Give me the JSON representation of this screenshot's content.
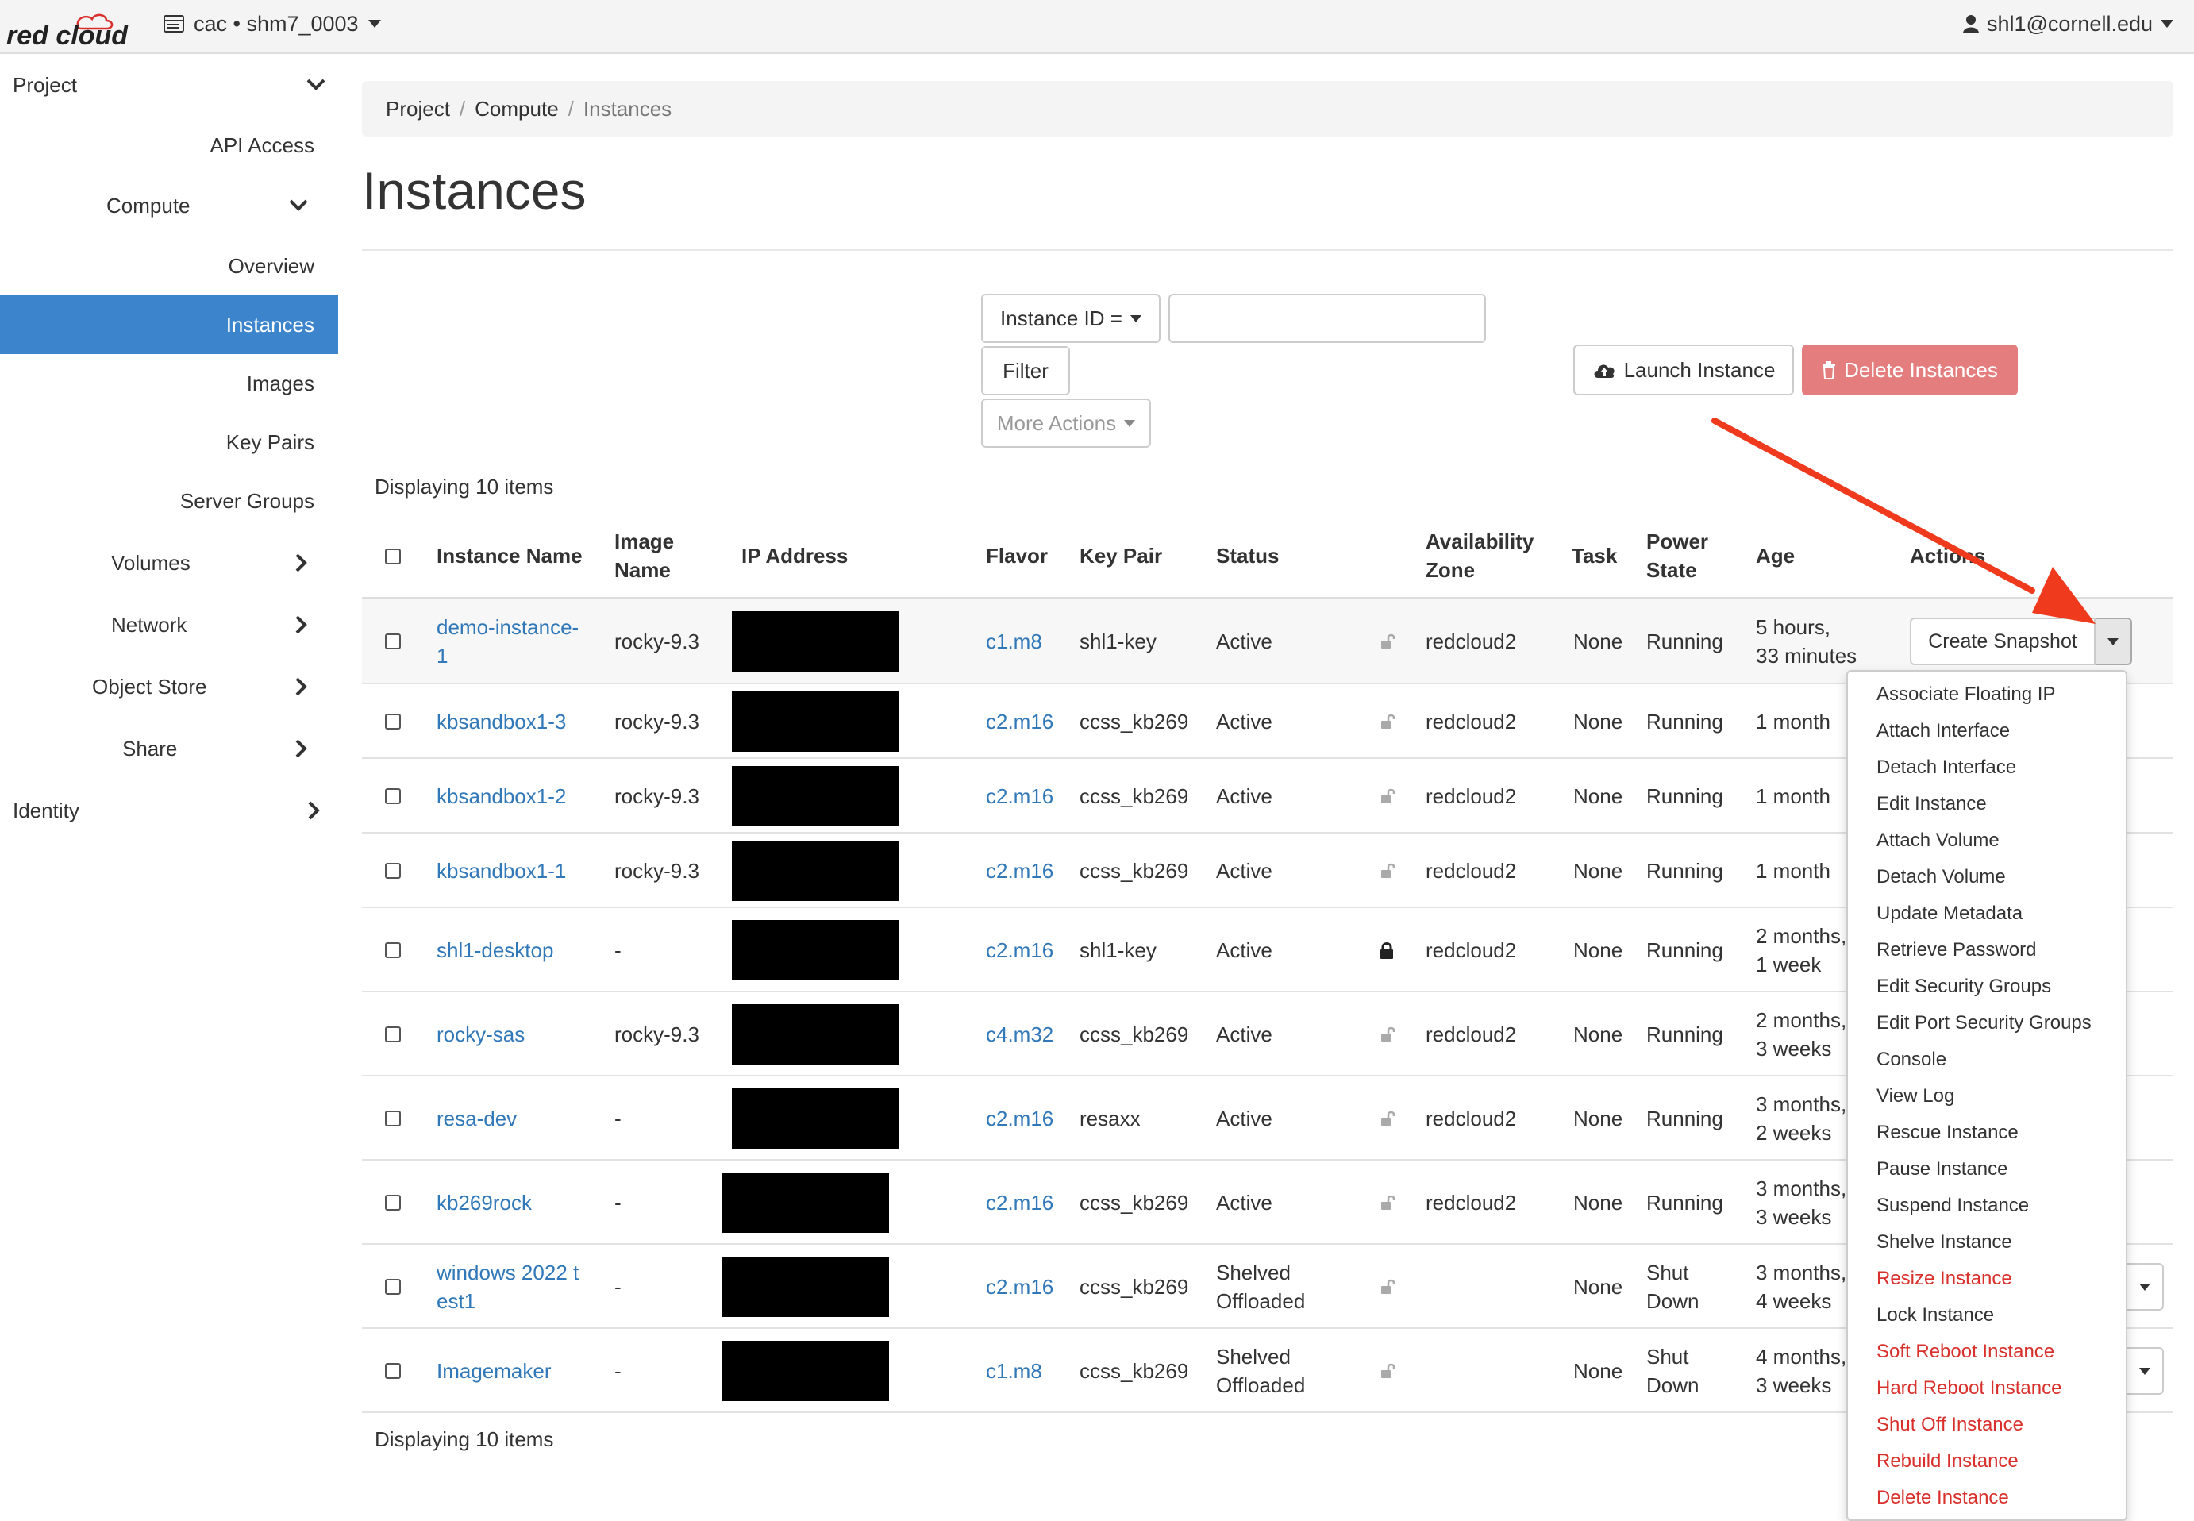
{
  "topbar": {
    "logo_text": "red cloud",
    "project_switcher": "cac • shm7_0003",
    "user": "shl1@cornell.edu"
  },
  "sidebar": {
    "project": "Project",
    "api_access": "API Access",
    "compute": "Compute",
    "overview": "Overview",
    "instances": "Instances",
    "images": "Images",
    "key_pairs": "Key Pairs",
    "server_groups": "Server Groups",
    "volumes": "Volumes",
    "network": "Network",
    "object_store": "Object Store",
    "share": "Share",
    "identity": "Identity"
  },
  "breadcrumb": [
    "Project",
    "Compute",
    "Instances"
  ],
  "page_title": "Instances",
  "filter": {
    "field_label": "Instance ID =",
    "input_value": "",
    "filter_label": "Filter",
    "more_actions_label": "More Actions"
  },
  "actions": {
    "launch_label": "Launch Instance",
    "delete_label": "Delete Instances"
  },
  "displaying": "Displaying 10 items",
  "table": {
    "headers": {
      "name": "Instance Name",
      "image_1": "Image",
      "image_2": "Name",
      "ip": "IP Address",
      "flavor": "Flavor",
      "keypair": "Key Pair",
      "status": "Status",
      "az_1": "Availability",
      "az_2": "Zone",
      "task": "Task",
      "power_1": "Power",
      "power_2": "State",
      "age": "Age",
      "actions": "Actions"
    },
    "rows": [
      {
        "name_1": "demo-instance-",
        "name_2": "1",
        "image": "rocky-9.3",
        "flavor": "c1.m8",
        "keypair": "shl1-key",
        "status_1": "Active",
        "status_2": "",
        "locked": false,
        "az": "redcloud2",
        "task": "None",
        "power_1": "Running",
        "power_2": "",
        "age_1": "5 hours,",
        "age_2": "33 minutes",
        "action": "Create Snapshot"
      },
      {
        "name_1": "kbsandbox1-3",
        "name_2": "",
        "image": "rocky-9.3",
        "flavor": "c2.m16",
        "keypair": "ccss_kb269",
        "status_1": "Active",
        "status_2": "",
        "locked": false,
        "az": "redcloud2",
        "task": "None",
        "power_1": "Running",
        "power_2": "",
        "age_1": "1 month",
        "age_2": "",
        "action": ""
      },
      {
        "name_1": "kbsandbox1-2",
        "name_2": "",
        "image": "rocky-9.3",
        "flavor": "c2.m16",
        "keypair": "ccss_kb269",
        "status_1": "Active",
        "status_2": "",
        "locked": false,
        "az": "redcloud2",
        "task": "None",
        "power_1": "Running",
        "power_2": "",
        "age_1": "1 month",
        "age_2": "",
        "action": ""
      },
      {
        "name_1": "kbsandbox1-1",
        "name_2": "",
        "image": "rocky-9.3",
        "flavor": "c2.m16",
        "keypair": "ccss_kb269",
        "status_1": "Active",
        "status_2": "",
        "locked": false,
        "az": "redcloud2",
        "task": "None",
        "power_1": "Running",
        "power_2": "",
        "age_1": "1 month",
        "age_2": "",
        "action": ""
      },
      {
        "name_1": "shl1-desktop",
        "name_2": "",
        "image": "-",
        "flavor": "c2.m16",
        "keypair": "shl1-key",
        "status_1": "Active",
        "status_2": "",
        "locked": true,
        "az": "redcloud2",
        "task": "None",
        "power_1": "Running",
        "power_2": "",
        "age_1": "2 months,",
        "age_2": "1 week",
        "action": ""
      },
      {
        "name_1": "rocky-sas",
        "name_2": "",
        "image": "rocky-9.3",
        "flavor": "c4.m32",
        "keypair": "ccss_kb269",
        "status_1": "Active",
        "status_2": "",
        "locked": false,
        "az": "redcloud2",
        "task": "None",
        "power_1": "Running",
        "power_2": "",
        "age_1": "2 months,",
        "age_2": "3 weeks",
        "action": ""
      },
      {
        "name_1": "resa-dev",
        "name_2": "",
        "image": "-",
        "flavor": "c2.m16",
        "keypair": "resaxx",
        "status_1": "Active",
        "status_2": "",
        "locked": false,
        "az": "redcloud2",
        "task": "None",
        "power_1": "Running",
        "power_2": "",
        "age_1": "3 months,",
        "age_2": "2 weeks",
        "action": ""
      },
      {
        "name_1": "kb269rock",
        "name_2": "",
        "image": "-",
        "flavor": "c2.m16",
        "keypair": "ccss_kb269",
        "status_1": "Active",
        "status_2": "",
        "locked": false,
        "az": "redcloud2",
        "task": "None",
        "power_1": "Running",
        "power_2": "",
        "age_1": "3 months,",
        "age_2": "3 weeks",
        "action": ""
      },
      {
        "name_1": "windows 2022 t",
        "name_2": "est1",
        "image": "-",
        "flavor": "c2.m16",
        "keypair": "ccss_kb269",
        "status_1": "Shelved",
        "status_2": "Offloaded",
        "locked": false,
        "az": "",
        "task": "None",
        "power_1": "Shut",
        "power_2": "Down",
        "age_1": "3 months,",
        "age_2": "4 weeks",
        "action": ""
      },
      {
        "name_1": "Imagemaker",
        "name_2": "",
        "image": "-",
        "flavor": "c1.m8",
        "keypair": "ccss_kb269",
        "status_1": "Shelved",
        "status_2": "Offloaded",
        "locked": false,
        "az": "",
        "task": "None",
        "power_1": "Shut",
        "power_2": "Down",
        "age_1": "4 months,",
        "age_2": "3 weeks",
        "action": ""
      }
    ]
  },
  "dropdown": {
    "items": [
      {
        "label": "Associate Floating IP",
        "danger": false
      },
      {
        "label": "Attach Interface",
        "danger": false
      },
      {
        "label": "Detach Interface",
        "danger": false
      },
      {
        "label": "Edit Instance",
        "danger": false
      },
      {
        "label": "Attach Volume",
        "danger": false
      },
      {
        "label": "Detach Volume",
        "danger": false
      },
      {
        "label": "Update Metadata",
        "danger": false
      },
      {
        "label": "Retrieve Password",
        "danger": false
      },
      {
        "label": "Edit Security Groups",
        "danger": false
      },
      {
        "label": "Edit Port Security Groups",
        "danger": false
      },
      {
        "label": "Console",
        "danger": false
      },
      {
        "label": "View Log",
        "danger": false
      },
      {
        "label": "Rescue Instance",
        "danger": false
      },
      {
        "label": "Pause Instance",
        "danger": false
      },
      {
        "label": "Suspend Instance",
        "danger": false
      },
      {
        "label": "Shelve Instance",
        "danger": false
      },
      {
        "label": "Resize Instance",
        "danger": true
      },
      {
        "label": "Lock Instance",
        "danger": false
      },
      {
        "label": "Soft Reboot Instance",
        "danger": true
      },
      {
        "label": "Hard Reboot Instance",
        "danger": true
      },
      {
        "label": "Shut Off Instance",
        "danger": true
      },
      {
        "label": "Rebuild Instance",
        "danger": true
      },
      {
        "label": "Delete Instance",
        "danger": true
      }
    ]
  },
  "colors": {
    "link": "#3178b8",
    "active_nav": "#3c84cc",
    "danger_text": "#d9302c",
    "delete_button": "#e47e7e",
    "annotation_arrow": "#f03a1e"
  }
}
